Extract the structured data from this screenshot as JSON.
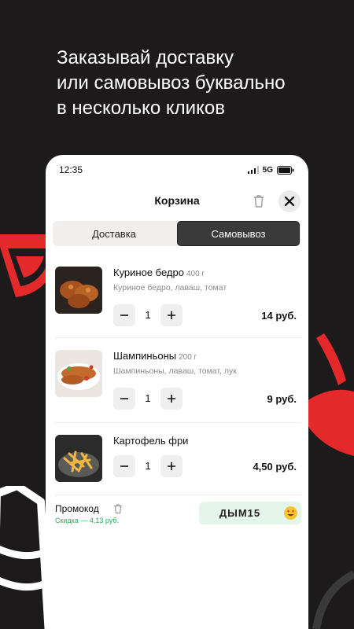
{
  "headline": {
    "lines": [
      "Заказывай доставку",
      "или самовывоз буквально",
      "в несколько кликов"
    ]
  },
  "status_bar": {
    "time": "12:35",
    "network": "5G"
  },
  "cart": {
    "title": "Корзина",
    "tabs": [
      {
        "label": "Доставка",
        "active": false
      },
      {
        "label": "Самовывоз",
        "active": true
      }
    ],
    "items": [
      {
        "name": "Куриное бедро",
        "weight": "400 г",
        "description": "Куриное бедро, лаваш, томат",
        "quantity": "1",
        "price": "14 руб.",
        "image_icon": "chicken-thigh-photo"
      },
      {
        "name": "Шампиньоны",
        "weight": "200 г",
        "description": "Шампиньоны, лаваш, томат, лук",
        "quantity": "1",
        "price": "9 руб.",
        "image_icon": "mushroom-skewers-photo"
      },
      {
        "name": "Картофель фри",
        "weight": "",
        "description": "",
        "quantity": "1",
        "price": "4,50 руб.",
        "image_icon": "french-fries-photo"
      }
    ],
    "promo": {
      "label": "Промокод",
      "discount": "Скидка — 4,13 руб.",
      "code": "ДЫМ15",
      "emoji_icon": "heart-eyes-emoji"
    }
  },
  "colors": {
    "background": "#1c1a1b",
    "accent_red": "#e4292b",
    "active_tab": "#3a3a3a",
    "promo_green": "#2bab57",
    "promo_field": "#e6f5ea"
  }
}
